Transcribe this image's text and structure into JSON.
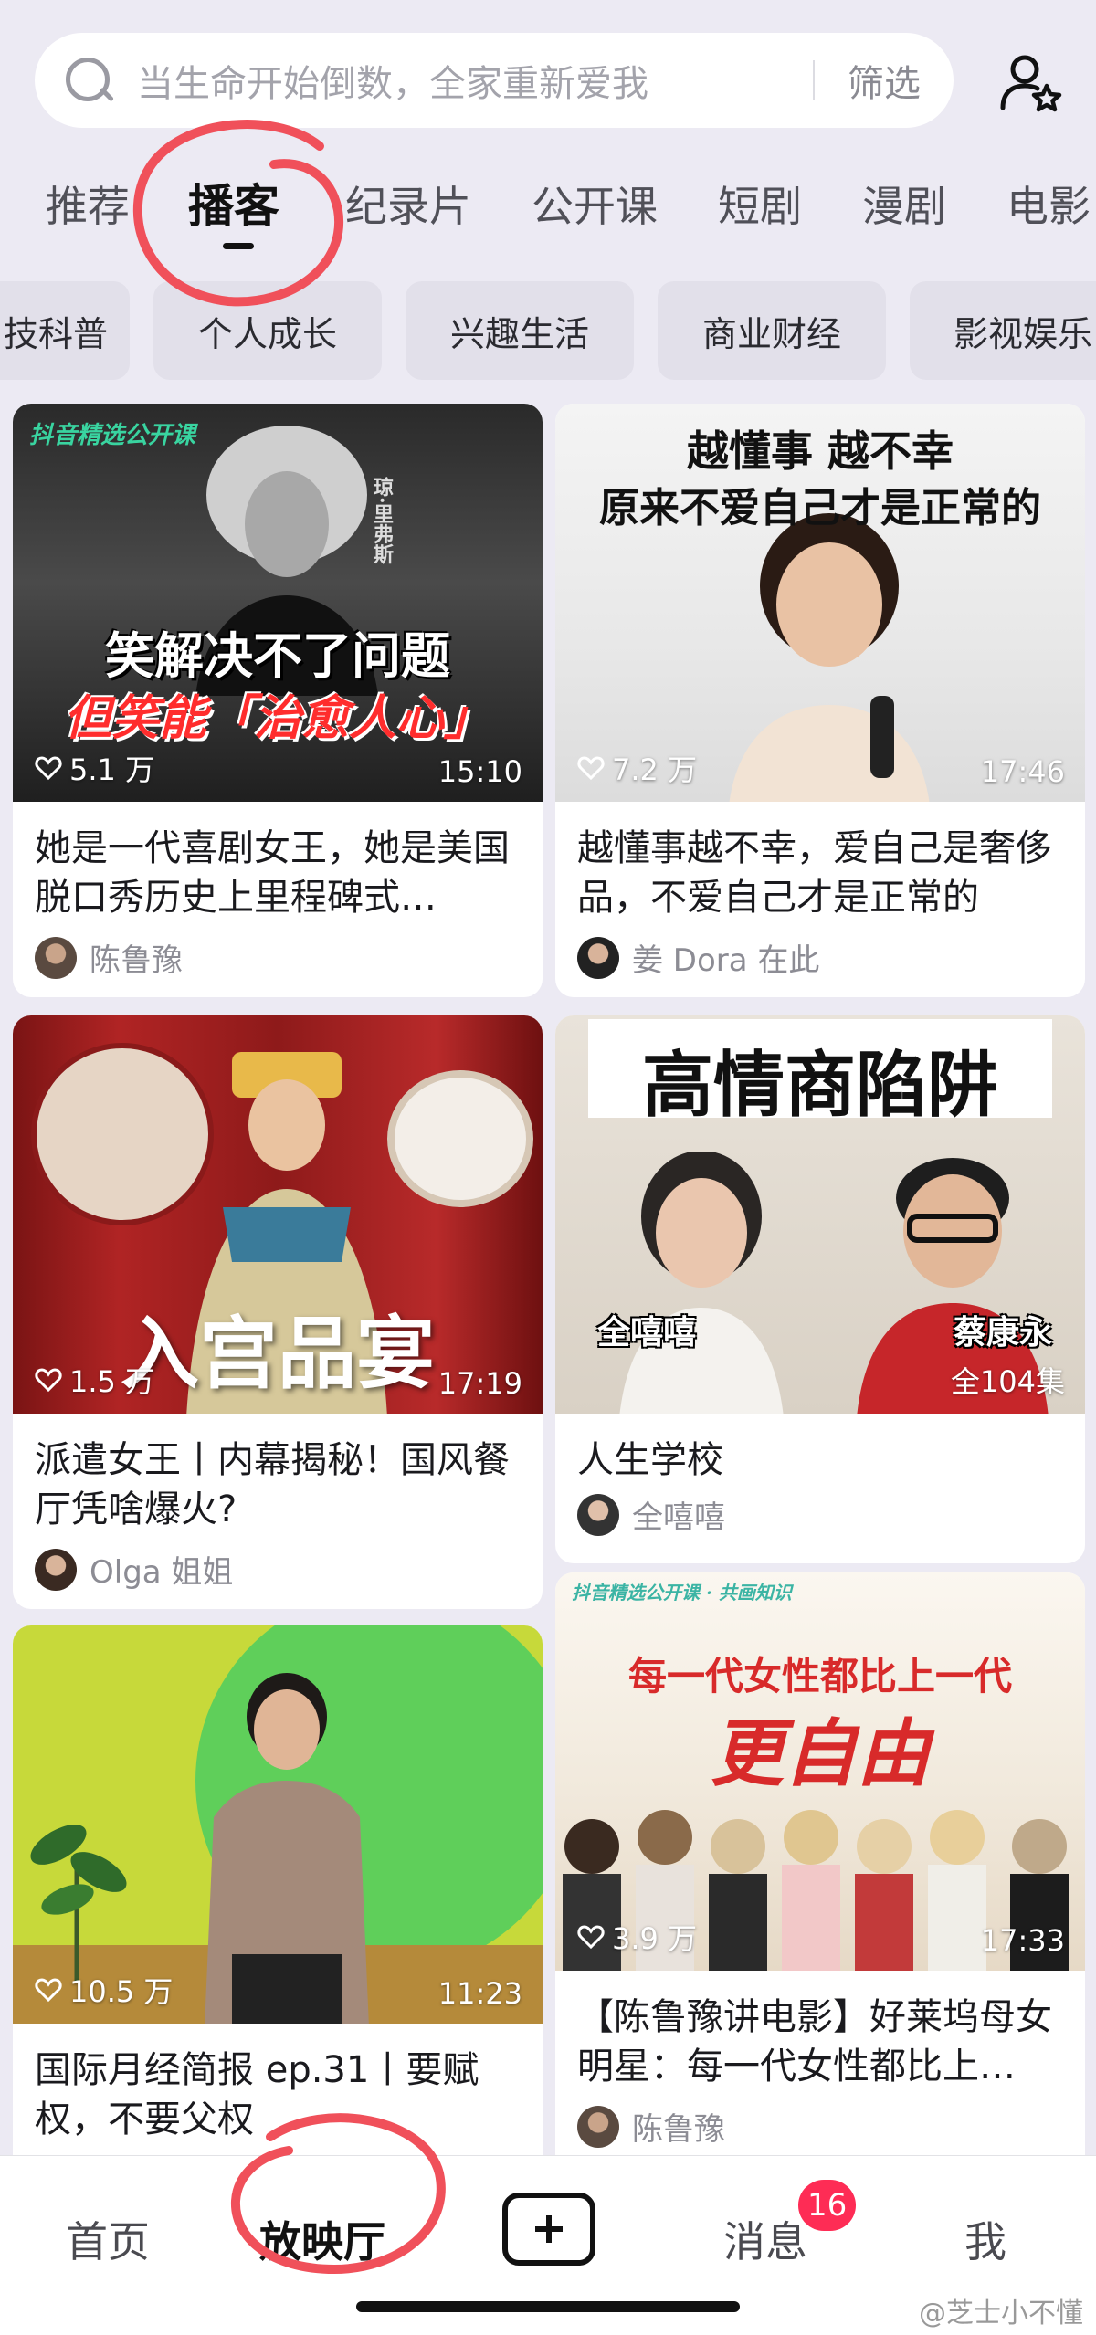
{
  "search": {
    "placeholder": "当生命开始倒数，全家重新爱我",
    "filter_label": "筛选"
  },
  "tabs": [
    {
      "label": "推荐"
    },
    {
      "label": "播客"
    },
    {
      "label": "纪录片"
    },
    {
      "label": "公开课"
    },
    {
      "label": "短剧"
    },
    {
      "label": "漫剧"
    },
    {
      "label": "电影"
    }
  ],
  "chips": [
    {
      "label": "技科普"
    },
    {
      "label": "个人成长"
    },
    {
      "label": "兴趣生活"
    },
    {
      "label": "商业财经"
    },
    {
      "label": "影视娱乐"
    }
  ],
  "cards": [
    {
      "likes": "5.1 万",
      "duration": "15:10",
      "title": "她是一代喜剧女王，她是美国脱口秀历史上里程碑式…",
      "author": "陈鲁豫",
      "overlay_badge": "抖音精选公开课",
      "overlay_name": "琼·里弗斯",
      "overlay_line1": "笑解决不了问题",
      "overlay_line2": "但笑能「治愈人心」"
    },
    {
      "likes": "7.2 万",
      "duration": "17:46",
      "title": "越懂事越不幸，爱自己是奢侈品，不爱自己才是正常的",
      "author": "姜 Dora 在此",
      "overlay_line1": "越懂事  越不幸",
      "overlay_line2": "原来不爱自己才是正常的"
    },
    {
      "likes": "1.5 万",
      "duration": "17:19",
      "title": "派遣女王丨内幕揭秘！国风餐厅凭啥爆火?",
      "author": "Olga 姐姐",
      "overlay_line1": "入宫品宴"
    },
    {
      "episodes": "全104集",
      "title": "人生学校",
      "author": "全嘻嘻",
      "overlay_line1": "高情商陷阱",
      "overlay_name_left": "全嘻嘻",
      "overlay_name_right": "蔡康永"
    },
    {
      "likes": "10.5 万",
      "duration": "11:23",
      "title": "国际月经简报 ep.31丨要赋权，不要父权"
    },
    {
      "likes": "3.9 万",
      "duration": "17:33",
      "title": "【陈鲁豫讲电影】好莱坞母女明星：每一代女性都比上…",
      "author": "陈鲁豫",
      "overlay_badge": "抖音精选公开课 · 共画知识",
      "overlay_line1": "每一代女性都比上一代",
      "overlay_line2": "更自由"
    }
  ],
  "bottom_nav": {
    "home": "首页",
    "theater": "放映厅",
    "messages": "消息",
    "messages_badge": "16",
    "me": "我"
  },
  "watermark": "@芝士小不懂",
  "colors": {
    "accent": "#fe2c55",
    "annotation": "#f0505a",
    "background": "#eceaf3"
  }
}
